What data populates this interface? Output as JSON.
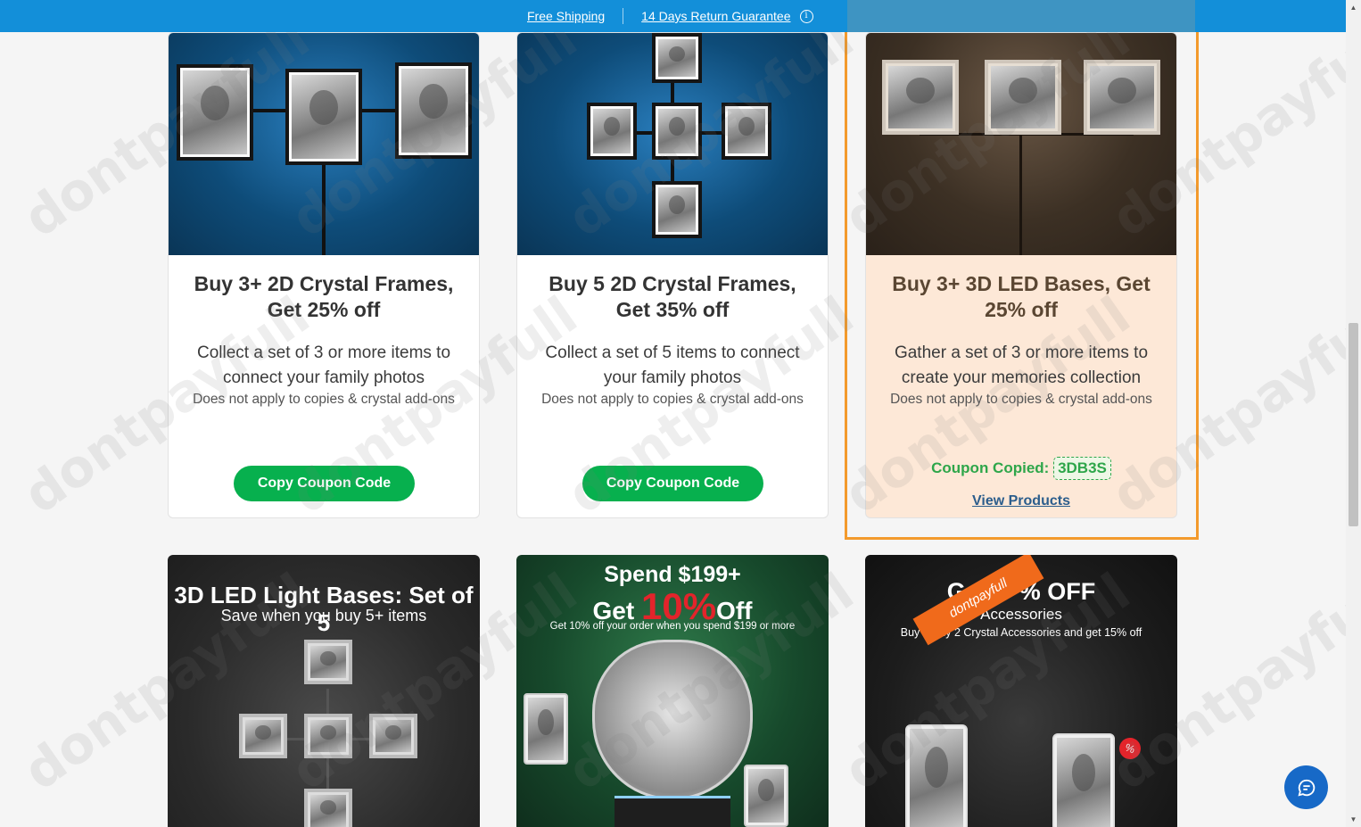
{
  "topbar": {
    "free_shipping": "Free Shipping",
    "return_guarantee": "14 Days Return Guarantee",
    "info_icon": "i"
  },
  "offers": [
    {
      "title": "Buy 3+ 2D Crystal Frames, Get 25% off",
      "description": "Collect a set of 3 or more items to connect your family photos",
      "note": "Does not apply to copies & crystal add-ons",
      "button": "Copy Coupon Code"
    },
    {
      "title": "Buy 5 2D Crystal Frames, Get 35% off",
      "description": "Collect a set of 5 items to connect your family photos",
      "note": "Does not apply to copies & crystal add-ons",
      "button": "Copy Coupon Code"
    },
    {
      "title": "Buy 3+ 3D LED Bases, Get 25% off",
      "description": "Gather a set of 3 or more items to create your memories collection",
      "note": "Does not apply to copies & crystal add-ons",
      "copied_label": "Coupon Copied:",
      "code": "3DB3S",
      "view_link": "View Products"
    }
  ],
  "banners": [
    {
      "headline": "3D LED Light Bases: Set of 5",
      "sub": "Save when you buy 5+ items"
    },
    {
      "line1": "Spend $199+",
      "line2_get": "Get",
      "line2_pct": "10%",
      "line2_off": "Off",
      "fine": "Get 10% off your order when you spend $199 or more"
    },
    {
      "headline_part1": "G",
      "headline_part2": "% OFF",
      "sub": "Accessories",
      "fine_part1": "Buy",
      "fine_part2": "ny 2 Crystal Accessories and get 15% off",
      "ribbon": "dontpayfull"
    }
  ],
  "watermark": "dontpayfull",
  "colors": {
    "topbar": "#138fd9",
    "button": "#07b04e",
    "highlight": "#f39a2c",
    "active_card": "#fde8d7",
    "chat": "#1769c7"
  }
}
